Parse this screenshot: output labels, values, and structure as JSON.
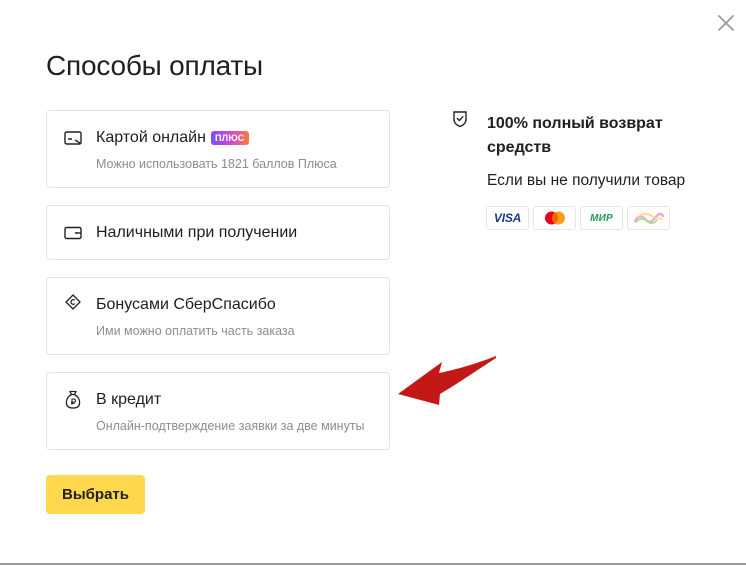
{
  "dialog": {
    "title": "Способы оплаты",
    "select_label": "Выбрать"
  },
  "options": [
    {
      "label": "Картой онлайн",
      "badge": "ПЛЮС",
      "sub": "Можно использовать 1821 баллов Плюса",
      "icon": "card-icon"
    },
    {
      "label": "Наличными при получении",
      "sub": "",
      "icon": "wallet-icon"
    },
    {
      "label": "Бонусами СберСпасибо",
      "sub": "Ими можно оплатить часть заказа",
      "icon": "sberspasibo-icon"
    },
    {
      "label": "В кредит",
      "sub": "Онлайн-подтверждение заявки за две минуты",
      "icon": "money-bag-icon"
    }
  ],
  "guarantee": {
    "title": "100% полный возврат средств",
    "sub": "Если вы не получили товар"
  },
  "payment_systems": {
    "visa": "VISA",
    "mir": "МИР"
  },
  "colors": {
    "accent_button": "#ffd84d",
    "annotation_arrow": "#c41818",
    "text_primary": "#21201f",
    "text_secondary": "#8d8d8d"
  }
}
